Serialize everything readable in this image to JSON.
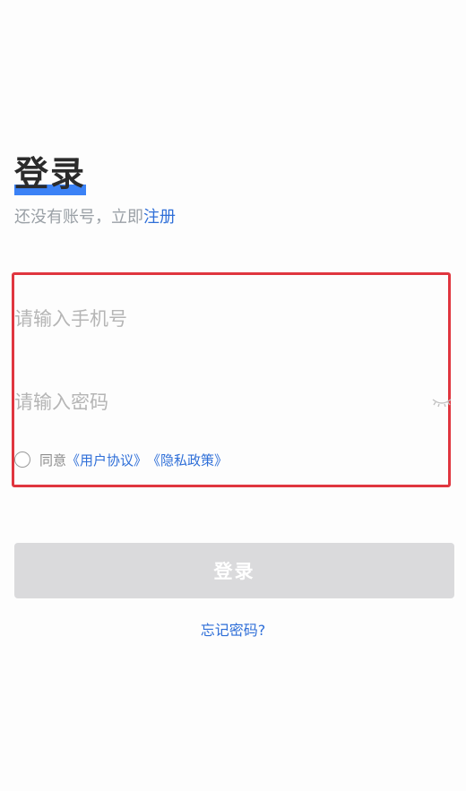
{
  "header": {
    "title": "登录",
    "subtitle_prefix": "还没有账号，立即",
    "register_link": "注册"
  },
  "form": {
    "phone_placeholder": "请输入手机号",
    "password_placeholder": "请输入密码",
    "agree_prefix": "同意",
    "user_agreement": "《用户协议》",
    "privacy_policy": "《隐私政策》"
  },
  "actions": {
    "login_button": "登录",
    "forgot_password": "忘记密码?"
  },
  "colors": {
    "accent": "#2f6fd8",
    "title_underline": "#3b82f6",
    "highlight_border": "#e0363f",
    "button_disabled": "#dadadc"
  }
}
